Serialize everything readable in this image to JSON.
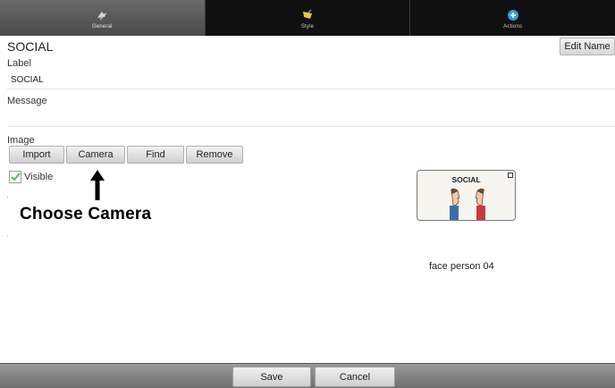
{
  "tabs": [
    {
      "label": "General",
      "icon": "general-tab-icon",
      "active": true
    },
    {
      "label": "Style",
      "icon": "style-tab-icon",
      "active": false
    },
    {
      "label": "Actions",
      "icon": "actions-plus-icon",
      "active": false
    }
  ],
  "header": {
    "title": "SOCIAL",
    "edit_name_label": "Edit Name"
  },
  "label_field": {
    "label": "Label",
    "value": "SOCIAL"
  },
  "message_field": {
    "label": "Message",
    "value": ""
  },
  "image": {
    "label": "Image",
    "buttons": [
      "Import",
      "Camera",
      "Find",
      "Remove"
    ]
  },
  "visible": {
    "label": "Visible",
    "checked": true,
    "check_color": "#5cb85c"
  },
  "annotation": {
    "text": "Choose Camera"
  },
  "preview": {
    "title": "SOCIAL",
    "caption": "face person 04"
  },
  "footer": {
    "save_label": "Save",
    "cancel_label": "Cancel"
  },
  "colors": {
    "tabbar": "#101010",
    "active_tab": "#5a5a5a",
    "actions_icon": "#2aa0d6",
    "style_icon": "#e2c84a"
  }
}
